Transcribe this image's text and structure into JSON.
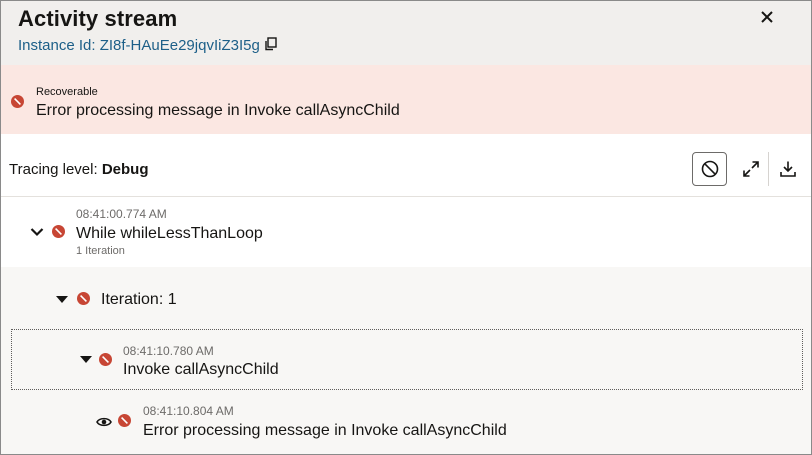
{
  "panel": {
    "title": "Activity stream",
    "instance_label": "Instance Id: ZI8f-HAuEe29jqvIiZ3I5g"
  },
  "banner": {
    "severity": "Recoverable",
    "message": "Error processing message in Invoke callAsyncChild"
  },
  "toolbar": {
    "tracing_prefix": "Tracing level: ",
    "tracing_value": "Debug"
  },
  "stream": {
    "items": [
      {
        "timestamp": "08:41:00.774 AM",
        "label": "While whileLessThanLoop",
        "sub": "1 Iteration"
      },
      {
        "timestamp": "",
        "label": "Iteration: 1",
        "sub": ""
      },
      {
        "timestamp": "08:41:10.780 AM",
        "label": "Invoke callAsyncChild",
        "sub": ""
      },
      {
        "timestamp": "08:41:10.804 AM",
        "label": "Error processing message in Invoke callAsyncChild",
        "sub": ""
      }
    ]
  },
  "colors": {
    "error": "#c74634",
    "banner_bg": "#fbe7e2",
    "header_bg": "#f1efed",
    "link": "#1d5f88"
  },
  "icons": {
    "copy": "copy-icon",
    "close": "close-icon",
    "error": "error-icon",
    "cancel": "cancel-icon",
    "expand": "expand-icon",
    "download": "download-icon",
    "eye": "eye-icon"
  }
}
